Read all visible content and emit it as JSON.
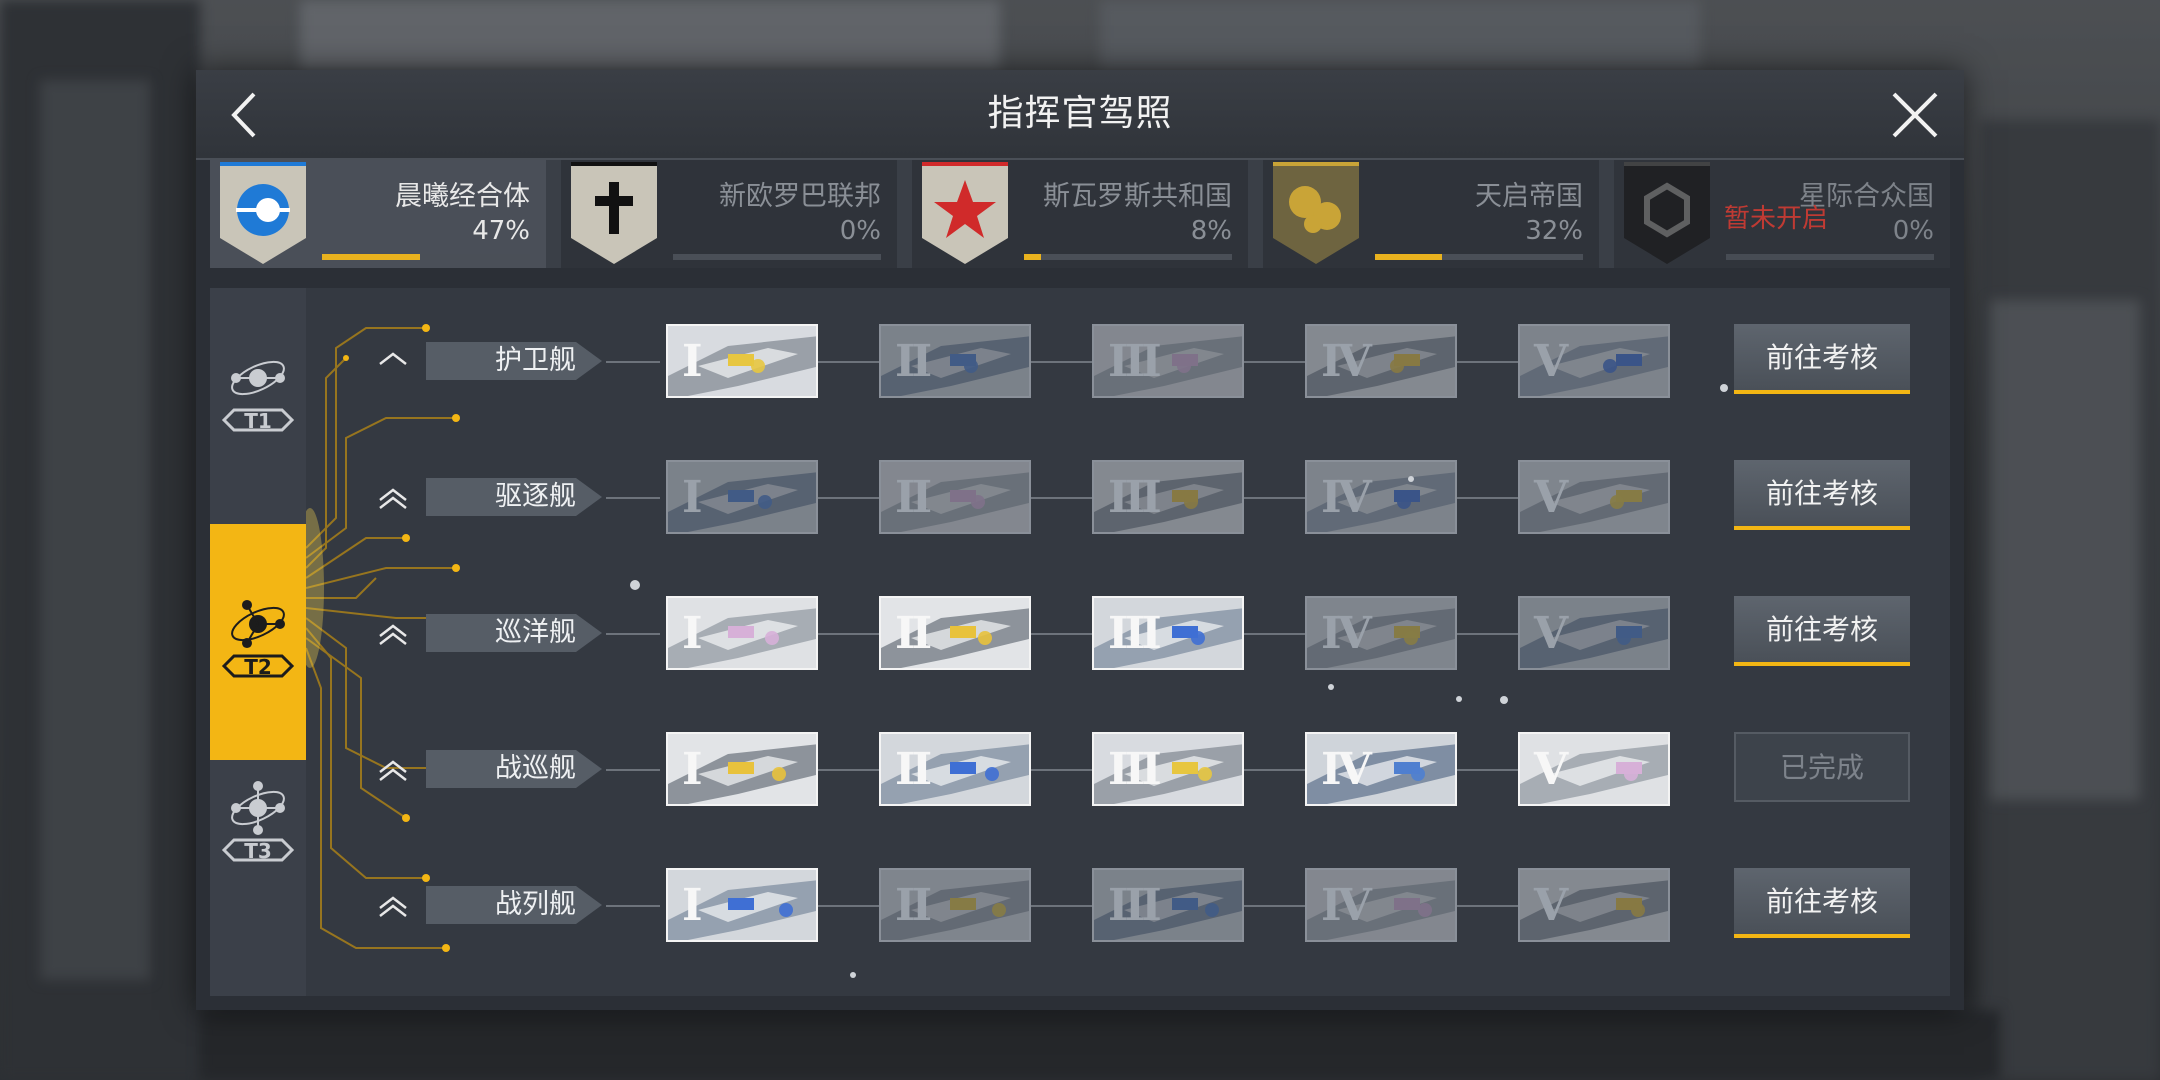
{
  "title": "指挥官驾照",
  "factions": [
    {
      "name": "晨曦经合体",
      "percent": "47%",
      "progress": 0.47,
      "active": true,
      "locked_text": "",
      "color": "#1f7ad6"
    },
    {
      "name": "新欧罗巴联邦",
      "percent": "0%",
      "progress": 0,
      "active": false,
      "locked_text": "",
      "color": "#111111"
    },
    {
      "name": "斯瓦罗斯共和国",
      "percent": "8%",
      "progress": 0.08,
      "active": false,
      "locked_text": "",
      "color": "#d02a2a"
    },
    {
      "name": "天启帝国",
      "percent": "32%",
      "progress": 0.32,
      "active": false,
      "locked_text": "",
      "color": "#c9a437"
    },
    {
      "name": "星际合众国",
      "percent": "0%",
      "progress": 0,
      "active": false,
      "locked_text": "暂未开启",
      "color": "#444444"
    }
  ],
  "tiers": [
    {
      "label": "T1",
      "active": false
    },
    {
      "label": "T2",
      "active": true
    },
    {
      "label": "T3",
      "active": false
    }
  ],
  "rows": [
    {
      "name": "护卫舰",
      "ships": [
        "I",
        "II",
        "III",
        "IV",
        "V"
      ],
      "unlocked": [
        true,
        false,
        false,
        false,
        false
      ],
      "action": "前往考核",
      "done": false
    },
    {
      "name": "驱逐舰",
      "ships": [
        "I",
        "II",
        "III",
        "IV",
        "V"
      ],
      "unlocked": [
        false,
        false,
        false,
        false,
        false
      ],
      "action": "前往考核",
      "done": false
    },
    {
      "name": "巡洋舰",
      "ships": [
        "I",
        "II",
        "III",
        "IV",
        "V"
      ],
      "unlocked": [
        true,
        true,
        true,
        false,
        false
      ],
      "action": "前往考核",
      "done": false
    },
    {
      "name": "战巡舰",
      "ships": [
        "I",
        "II",
        "III",
        "IV",
        "V"
      ],
      "unlocked": [
        true,
        true,
        true,
        true,
        true
      ],
      "action": "已完成",
      "done": true
    },
    {
      "name": "战列舰",
      "ships": [
        "I",
        "II",
        "III",
        "IV",
        "V"
      ],
      "unlocked": [
        true,
        false,
        false,
        false,
        false
      ],
      "action": "前往考核",
      "done": false
    }
  ],
  "accent": "#f3b614"
}
